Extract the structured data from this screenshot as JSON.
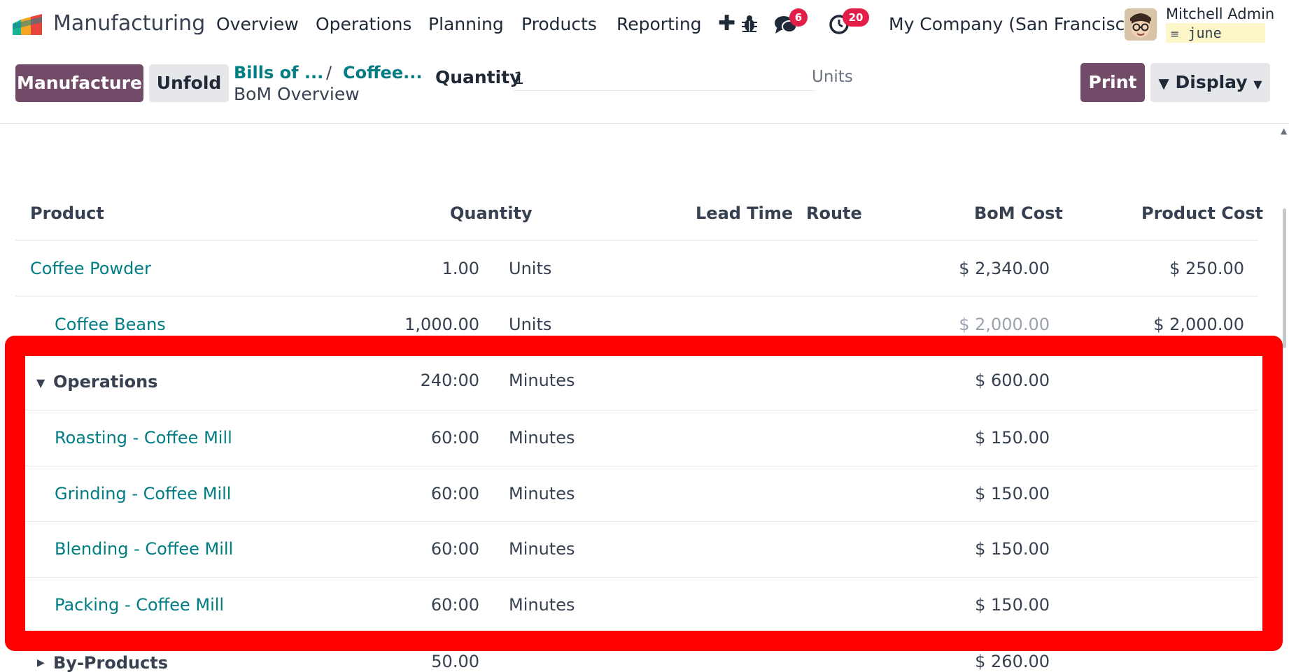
{
  "navbar": {
    "app_name": "Manufacturing",
    "menu": [
      "Overview",
      "Operations",
      "Planning",
      "Products",
      "Reporting"
    ],
    "chat_badge": "6",
    "activity_badge": "20",
    "company": "My Company (San Francisco)",
    "user_name": "Mitchell Admin",
    "database": "june"
  },
  "control_panel": {
    "manufacture_label": "Manufacture",
    "unfold_label": "Unfold",
    "breadcrumb": [
      "Bills of ...",
      "Coffee..."
    ],
    "breadcrumb_separator": "/",
    "current_page": "BoM Overview",
    "quantity_label": "Quantity",
    "quantity_value": "1",
    "quantity_unit": "Units",
    "print_label": "Print",
    "display_label": "Display"
  },
  "table": {
    "columns": [
      "Product",
      "Quantity",
      "Lead Time",
      "Route",
      "BoM Cost",
      "Product Cost"
    ],
    "rows": [
      {
        "name": "Coffee Powder",
        "qty": "1.00",
        "unit": "Units",
        "bom_cost": "$ 2,340.00",
        "product_cost": "$ 250.00"
      },
      {
        "name": "Coffee Beans",
        "qty": "1,000.00",
        "unit": "Units",
        "bom_cost": "$ 2,000.00",
        "product_cost": "$ 2,000.00"
      },
      {
        "name": "Operations",
        "qty": "240:00",
        "unit": "Minutes",
        "bom_cost": "$ 600.00",
        "product_cost": ""
      },
      {
        "name": "Roasting - Coffee Mill",
        "qty": "60:00",
        "unit": "Minutes",
        "bom_cost": "$ 150.00",
        "product_cost": ""
      },
      {
        "name": "Grinding - Coffee Mill",
        "qty": "60:00",
        "unit": "Minutes",
        "bom_cost": "$ 150.00",
        "product_cost": ""
      },
      {
        "name": "Blending - Coffee Mill",
        "qty": "60:00",
        "unit": "Minutes",
        "bom_cost": "$ 150.00",
        "product_cost": ""
      },
      {
        "name": "Packing - Coffee Mill",
        "qty": "60:00",
        "unit": "Minutes",
        "bom_cost": "$ 150.00",
        "product_cost": ""
      },
      {
        "name": "By-Products",
        "qty": "50.00",
        "unit": "",
        "bom_cost": "$ 260.00",
        "product_cost": ""
      }
    ]
  },
  "colors": {
    "primary": "#714b67",
    "link": "#017e84",
    "badge": "#e11d48",
    "highlight": "#ff0000"
  }
}
